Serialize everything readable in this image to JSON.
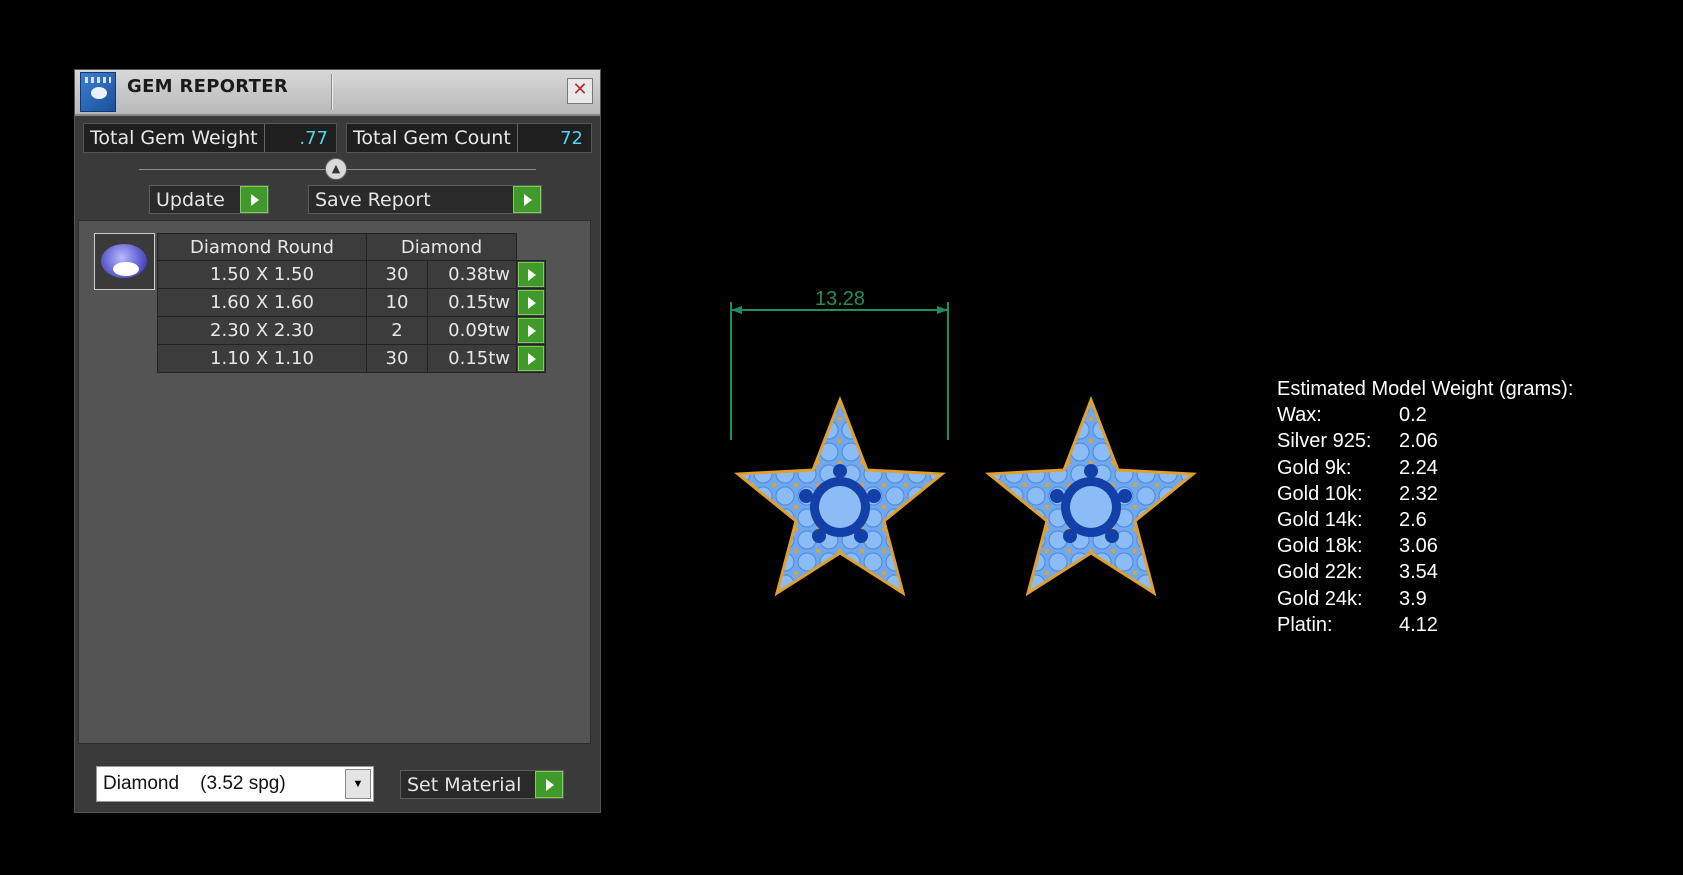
{
  "window": {
    "title": "GEM REPORTER",
    "close_glyph": "✕",
    "total_gem_weight_label": "Total Gem Weight",
    "total_gem_weight": ".77",
    "total_gem_count_label": "Total Gem Count",
    "total_gem_count": "72",
    "update_label": "Update",
    "save_report_label": "Save Report",
    "table": {
      "header_shape": "Diamond Round",
      "header_material": "Diamond",
      "rows": [
        {
          "size": "1.50 X 1.50",
          "count": "30",
          "tw": "0.38tw"
        },
        {
          "size": "1.60 X 1.60",
          "count": "10",
          "tw": "0.15tw"
        },
        {
          "size": "2.30 X 2.30",
          "count": "2",
          "tw": "0.09tw"
        },
        {
          "size": "1.10 X 1.10",
          "count": "30",
          "tw": "0.15tw"
        }
      ]
    },
    "material_select": "Diamond    (3.52 spg)",
    "set_material_label": "Set Material"
  },
  "viewport": {
    "dimension": "13.28",
    "weights_title": "Estimated Model Weight (grams):",
    "weights": [
      {
        "name": "Wax:",
        "value": "0.2"
      },
      {
        "name": "Silver 925:",
        "value": "2.06"
      },
      {
        "name": "Gold 9k:",
        "value": "2.24"
      },
      {
        "name": "Gold 10k:",
        "value": "2.32"
      },
      {
        "name": "Gold 14k:",
        "value": "2.6"
      },
      {
        "name": "Gold 18k:",
        "value": "3.06"
      },
      {
        "name": "Gold 22k:",
        "value": "3.54"
      },
      {
        "name": "Gold 24k:",
        "value": "3.9"
      },
      {
        "name": "Platin:",
        "value": "4.12"
      }
    ]
  },
  "colors": {
    "accent_value": "#4fd6ee",
    "go_button": "#3f9a2a",
    "dimension_line": "#1f8f5a",
    "star_stone": "#6ea8f0",
    "star_stone_dark": "#1340a8",
    "star_prong": "#e0a030"
  },
  "icons": [
    "app-icon",
    "close-icon",
    "slider-knob-icon",
    "arrow-right-icon",
    "gem-thumbnail-icon",
    "dropdown-arrow-icon"
  ]
}
